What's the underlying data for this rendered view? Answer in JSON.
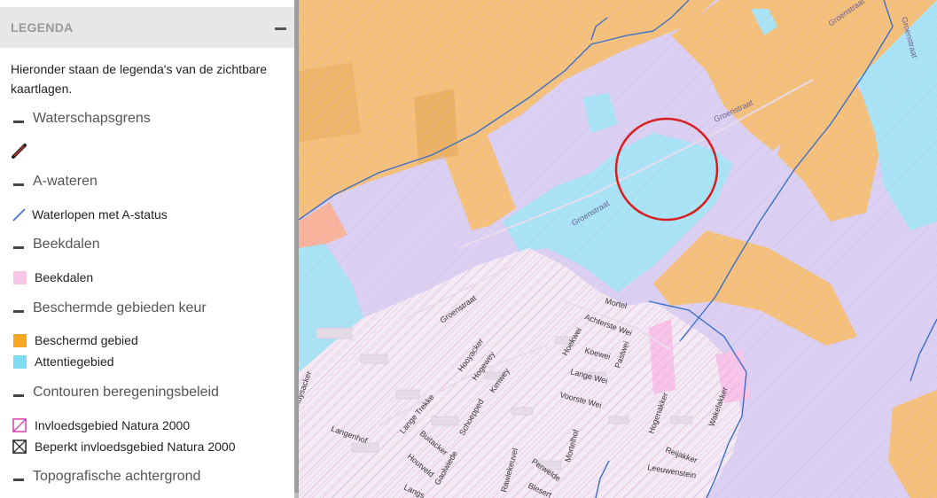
{
  "legend": {
    "title": "LEGENDA",
    "intro": "Hieronder staan de legenda's van de zichtbare kaartlagen.",
    "groups": [
      {
        "label": "Waterschapsgrens",
        "items": [
          {
            "label": "",
            "icon": "boundary-line-icon",
            "color": "#c0392b"
          }
        ]
      },
      {
        "label": "A-wateren",
        "items": [
          {
            "label": "Waterlopen met A-status",
            "icon": "waterway-line-icon",
            "color": "#3b6fc9"
          }
        ]
      },
      {
        "label": "Beekdalen",
        "items": [
          {
            "label": "Beekdalen",
            "icon": "fill-swatch",
            "color": "#f7c6e6"
          }
        ]
      },
      {
        "label": "Beschermde gebieden keur",
        "items": [
          {
            "label": "Beschermd gebied",
            "icon": "fill-swatch",
            "color": "#f5a623"
          },
          {
            "label": "Attentiegebied",
            "icon": "fill-swatch",
            "color": "#7fdcf2"
          }
        ]
      },
      {
        "label": "Contouren beregeningsbeleid",
        "items": [
          {
            "label": "Invloedsgebied Natura 2000",
            "icon": "hatched-swatch-pink",
            "color": "#d63fa8"
          },
          {
            "label": "Beperkt invloedsgebied Natura 2000",
            "icon": "hatched-swatch-black",
            "color": "#222222"
          }
        ]
      },
      {
        "label": "Topografische achtergrond",
        "items": []
      }
    ]
  },
  "map": {
    "colors": {
      "natura_purple": "#dbd0f2",
      "protected_orange": "#f5c07a",
      "attention_cyan": "#a8e4f5",
      "stream_valley_pink": "#f9c4e9",
      "residential": "#f4eaf4",
      "waterway": "#3b6fc9",
      "highlight_circle": "#d81e1e"
    },
    "streets": [
      "Groenstraat",
      "Groenstraat",
      "Groenstraat",
      "Groenstraat",
      "Groenstraat",
      "Mortel",
      "Achterste Wei",
      "Hoekwei",
      "Koewei",
      "Pastwei",
      "Lange Wei",
      "Voorste Wei",
      "Hooyacker",
      "Hogewey",
      "Kimwey",
      "Huysacker",
      "Langenhof",
      "Lange Trekke",
      "Buitacker",
      "Schoepped",
      "Houtveld",
      "Gaolwiede",
      "Hogenakker",
      "Wakelakker",
      "Mortelhof",
      "Perwelde",
      "Reijakker",
      "Leeuwenstein",
      "Rawiekeuvel",
      "Blesert",
      "Langs"
    ]
  }
}
